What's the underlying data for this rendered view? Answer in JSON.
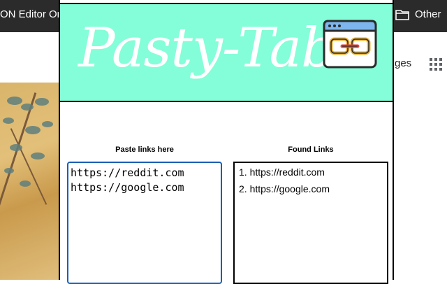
{
  "browser": {
    "bookmark_left_label": "ON Editor On",
    "bookmark_right_label": "Other",
    "folder_icon": "folder-icon"
  },
  "background_page": {
    "pages_label": "ges",
    "apps_icon": "apps-grid-icon"
  },
  "popup": {
    "title": "Pasty-Tabs",
    "logo_icon": "browser-link-icon",
    "header_color": "#84fed8",
    "paste_label": "Paste links here",
    "paste_value": "https://reddit.com\nhttps://google.com",
    "found_label": "Found Links",
    "found_links": [
      {
        "number": "1.",
        "url": "https://reddit.com"
      },
      {
        "number": "2.",
        "url": "https://google.com"
      }
    ]
  }
}
